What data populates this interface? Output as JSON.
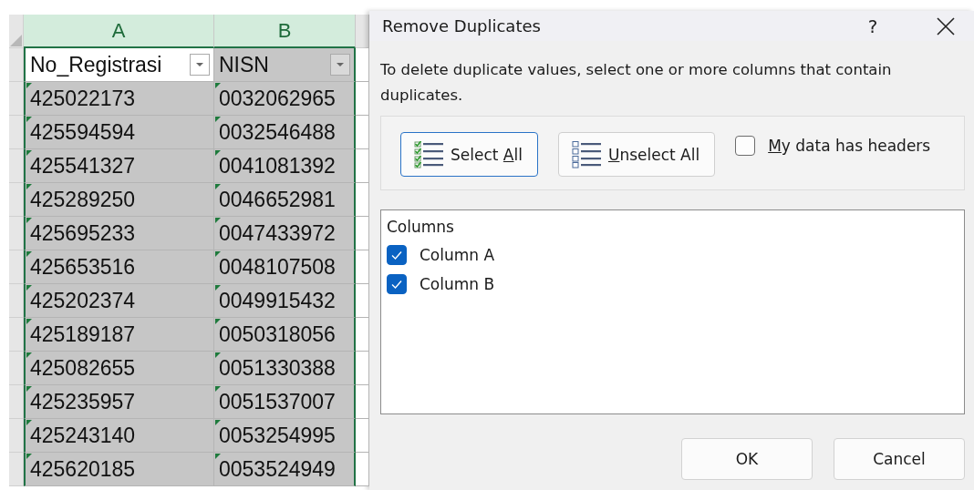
{
  "sheet": {
    "columns": [
      {
        "letter": "A",
        "selected": true
      },
      {
        "letter": "B",
        "selected": true
      }
    ],
    "header_row": [
      {
        "text": "No_Registrasi",
        "active": true
      },
      {
        "text": "NISN",
        "active": false
      }
    ],
    "rows": [
      [
        "425022173",
        "0032062965"
      ],
      [
        "425594594",
        "0032546488"
      ],
      [
        "425541327",
        "0041081392"
      ],
      [
        "425289250",
        "0046652981"
      ],
      [
        "425695233",
        "0047433972"
      ],
      [
        "425653516",
        "0048107508"
      ],
      [
        "425202374",
        "0049915432"
      ],
      [
        "425189187",
        "0050318056"
      ],
      [
        "425082655",
        "0051330388"
      ],
      [
        "425235957",
        "0051537007"
      ],
      [
        "425243140",
        "0053254995"
      ],
      [
        "425620185",
        "0053524949"
      ]
    ]
  },
  "dialog": {
    "title": "Remove Duplicates",
    "help": "?",
    "description": "To delete duplicate values, select one or more columns that contain duplicates.",
    "buttons": [
      {
        "kind": "select",
        "label": {
          "before": "Select ",
          "key": "A",
          "after": "ll"
        },
        "focused": true
      },
      {
        "kind": "unselect",
        "label": {
          "key": "U",
          "after": "nselect All"
        },
        "focused": false
      }
    ],
    "headers_option": {
      "label": {
        "key": "M",
        "after": "y data has headers"
      },
      "checked": false
    },
    "list": {
      "heading": "Columns",
      "items": [
        {
          "label": "Column A",
          "checked": true
        },
        {
          "label": "Column B",
          "checked": true
        }
      ]
    },
    "footer": [
      "OK",
      "Cancel"
    ]
  }
}
